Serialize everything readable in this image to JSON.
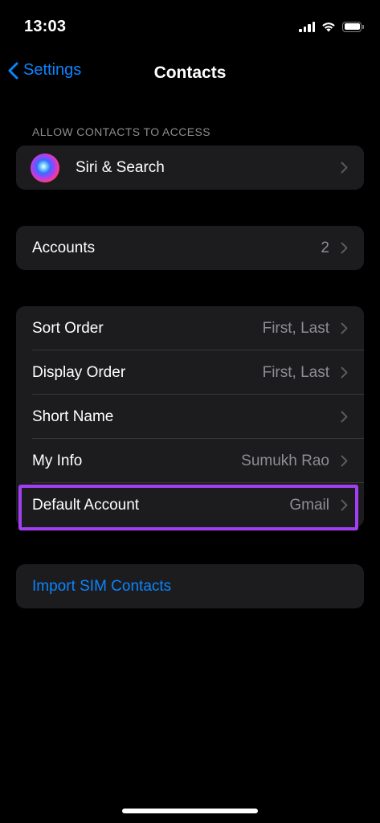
{
  "status_bar": {
    "time": "13:03"
  },
  "nav": {
    "back_label": "Settings",
    "title": "Contacts"
  },
  "sections": {
    "allow_access": {
      "header": "ALLOW CONTACTS TO ACCESS",
      "siri": {
        "label": "Siri & Search",
        "icon": "siri-icon"
      }
    },
    "accounts": {
      "label": "Accounts",
      "value": "2"
    },
    "settings": {
      "sort_order": {
        "label": "Sort Order",
        "value": "First, Last"
      },
      "display_order": {
        "label": "Display Order",
        "value": "First, Last"
      },
      "short_name": {
        "label": "Short Name"
      },
      "my_info": {
        "label": "My Info",
        "value": "Sumukh Rao"
      },
      "default_account": {
        "label": "Default Account",
        "value": "Gmail"
      }
    },
    "import": {
      "label": "Import SIM Contacts"
    }
  },
  "colors": {
    "background": "#000000",
    "cell": "#1c1c1e",
    "accent": "#0a84ff",
    "secondary_text": "#8d8d93",
    "highlight": "#a33ff2"
  }
}
